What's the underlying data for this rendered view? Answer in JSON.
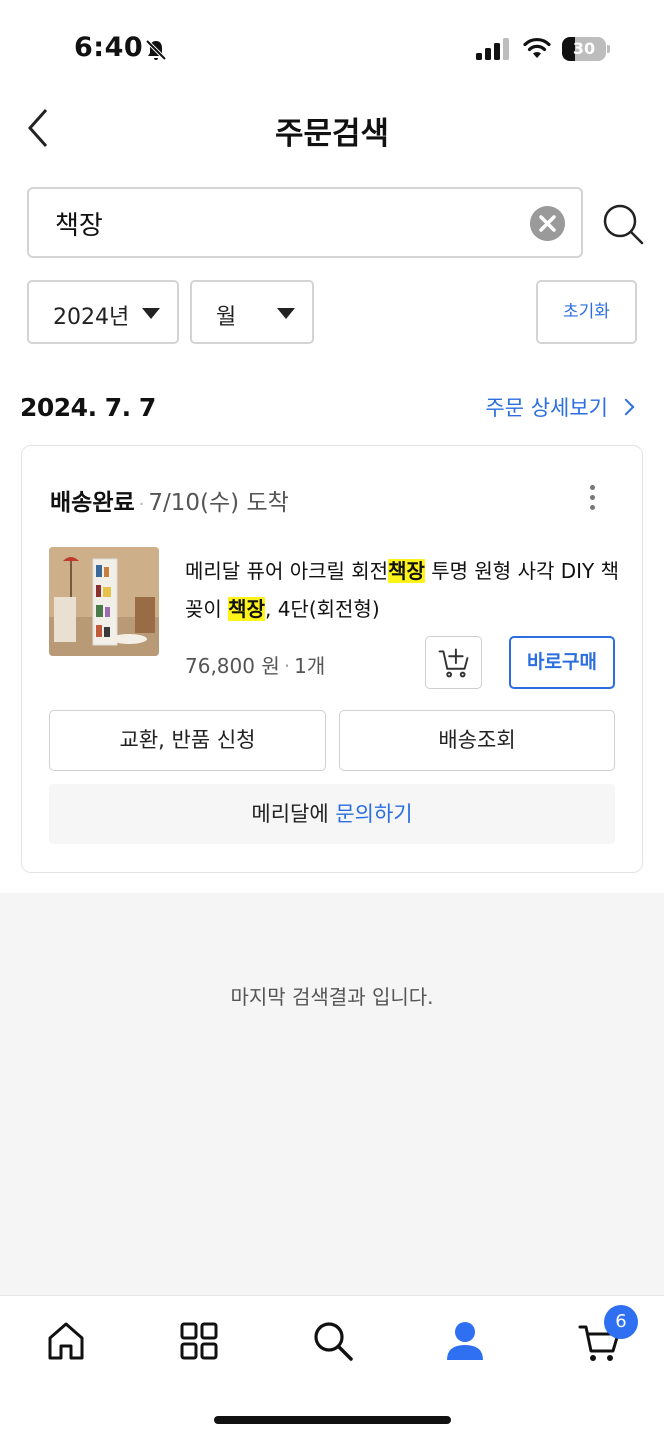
{
  "status_bar": {
    "time": "6:40",
    "battery_level": "30",
    "icons": [
      "bell-slash-icon",
      "signal-icon",
      "wifi-icon",
      "battery-icon"
    ]
  },
  "header": {
    "title": "주문검색",
    "back_icon": "chevron-left-icon"
  },
  "search": {
    "value": "책장",
    "clear_icon": "clear-circle-icon",
    "search_icon": "search-icon"
  },
  "filters": {
    "year": "2024년",
    "month": "월",
    "reset_label": "초기화"
  },
  "order": {
    "date": "2024. 7. 7",
    "detail_link": "주문 상세보기",
    "status": "배송완료",
    "status_separator": "·",
    "arrival": "7/10(수) 도착",
    "product": {
      "name_parts": [
        "메리달 퓨어 아크릴 회전",
        "책장",
        " 투명 원형 사각 DIY 책꽂이 ",
        "책장",
        ", 4단(회전형)"
      ],
      "price": "76,800 원",
      "separator": "·",
      "quantity": "1개"
    },
    "buy_now_label": "바로구매",
    "exchange_label": "교환, 반품 신청",
    "tracking_label": "배송조회",
    "inquiry_seller": "메리달에",
    "inquiry_link": "문의하기"
  },
  "end_message": "마지막 검색결과 입니다.",
  "tabbar": {
    "items": [
      "home-icon",
      "categories-icon",
      "search-icon",
      "my-page-icon",
      "cart-icon"
    ],
    "cart_badge": "6",
    "active_color": "#2f6ff2"
  },
  "colors": {
    "accent": "#2b6ee0",
    "highlight": "#fff41a"
  }
}
